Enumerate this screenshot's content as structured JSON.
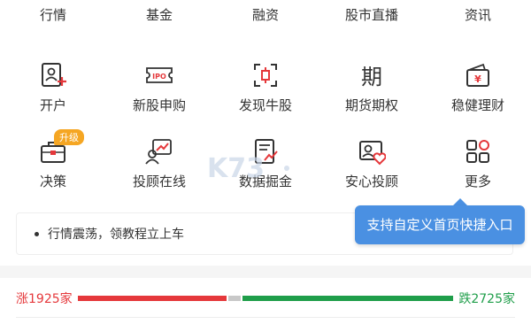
{
  "top_tabs": [
    {
      "label": "行情"
    },
    {
      "label": "基金"
    },
    {
      "label": "融资"
    },
    {
      "label": "股市直播"
    },
    {
      "label": "资讯"
    }
  ],
  "grid": {
    "row1": [
      {
        "label": "开户",
        "icon": "open-account-icon"
      },
      {
        "label": "新股申购",
        "icon": "ipo-ticket-icon",
        "icon_text": "IPO"
      },
      {
        "label": "发现牛股",
        "icon": "stock-discover-icon"
      },
      {
        "label": "期货期权",
        "icon": "futures-icon",
        "icon_text": "期"
      },
      {
        "label": "稳健理财",
        "icon": "wallet-icon",
        "icon_text": "¥"
      }
    ],
    "row2": [
      {
        "label": "决策",
        "icon": "toolbox-icon",
        "badge": "升级"
      },
      {
        "label": "投顾在线",
        "icon": "advisor-chart-icon"
      },
      {
        "label": "数据掘金",
        "icon": "document-chart-icon"
      },
      {
        "label": "安心投顾",
        "icon": "advisor-heart-icon"
      },
      {
        "label": "更多",
        "icon": "more-grid-icon"
      }
    ]
  },
  "notice": {
    "text": "行情震荡，领教程立上车"
  },
  "tooltip": {
    "text": "支持自定义首页快捷入口"
  },
  "market_breadth": {
    "up_label": "涨1925家",
    "down_label": "跌2725家",
    "up_count": 1925,
    "down_count": 2725
  },
  "colors": {
    "accent_red": "#e5383b",
    "accent_green": "#1f9e4a",
    "tooltip_blue": "#4a90e2",
    "badge_orange": "#f5a623"
  }
}
